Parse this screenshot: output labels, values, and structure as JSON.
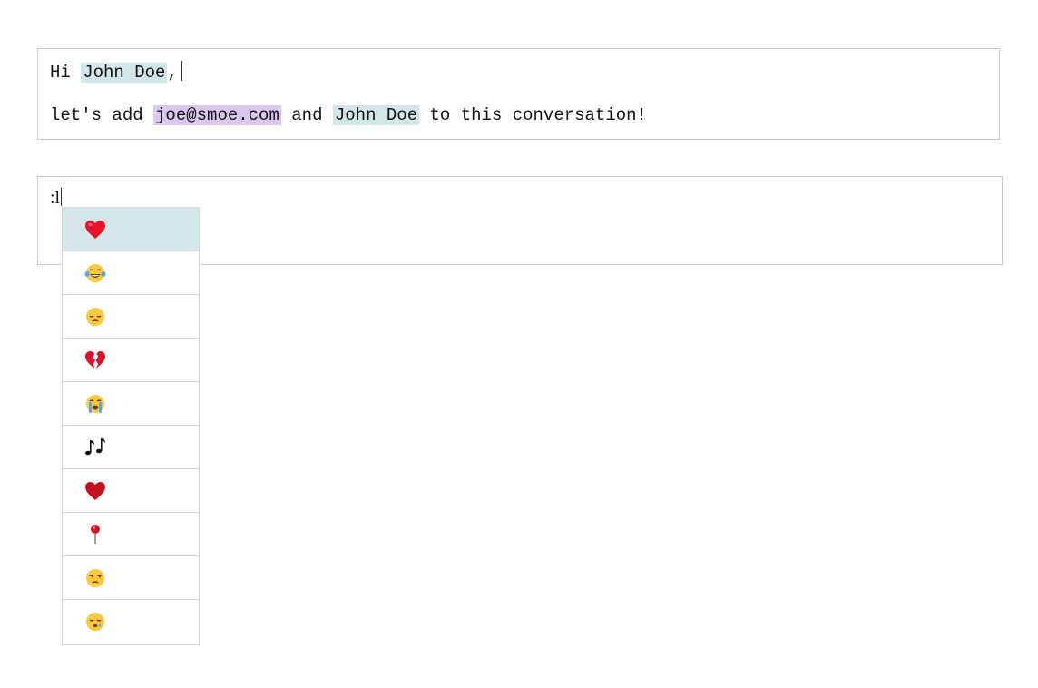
{
  "editor1": {
    "line1": {
      "prefix": "Hi ",
      "mention": "John Doe",
      "suffix": ","
    },
    "line2": {
      "prefix": "let's add ",
      "email_mention": "joe@smoe.com",
      "middle": " and ",
      "mention": "John Doe",
      "suffix": " to this conversation!"
    },
    "colors": {
      "mention_bg": "#d2e6e6",
      "email_mention_bg": "#d9c8ee"
    }
  },
  "editor2": {
    "text": ":l"
  },
  "emoji_suggestions": {
    "selected_index": 0,
    "selected_bg": "#d4e6e7",
    "items": [
      {
        "icon": "red-heart-icon"
      },
      {
        "icon": "face-with-tears-of-joy-icon"
      },
      {
        "icon": "pensive-face-icon"
      },
      {
        "icon": "broken-heart-icon"
      },
      {
        "icon": "loudly-crying-face-icon"
      },
      {
        "icon": "musical-notes-icon"
      },
      {
        "icon": "heavy-heart-icon"
      },
      {
        "icon": "round-pushpin-icon"
      },
      {
        "icon": "unamused-face-icon"
      },
      {
        "icon": "sleepy-face-icon"
      }
    ]
  }
}
